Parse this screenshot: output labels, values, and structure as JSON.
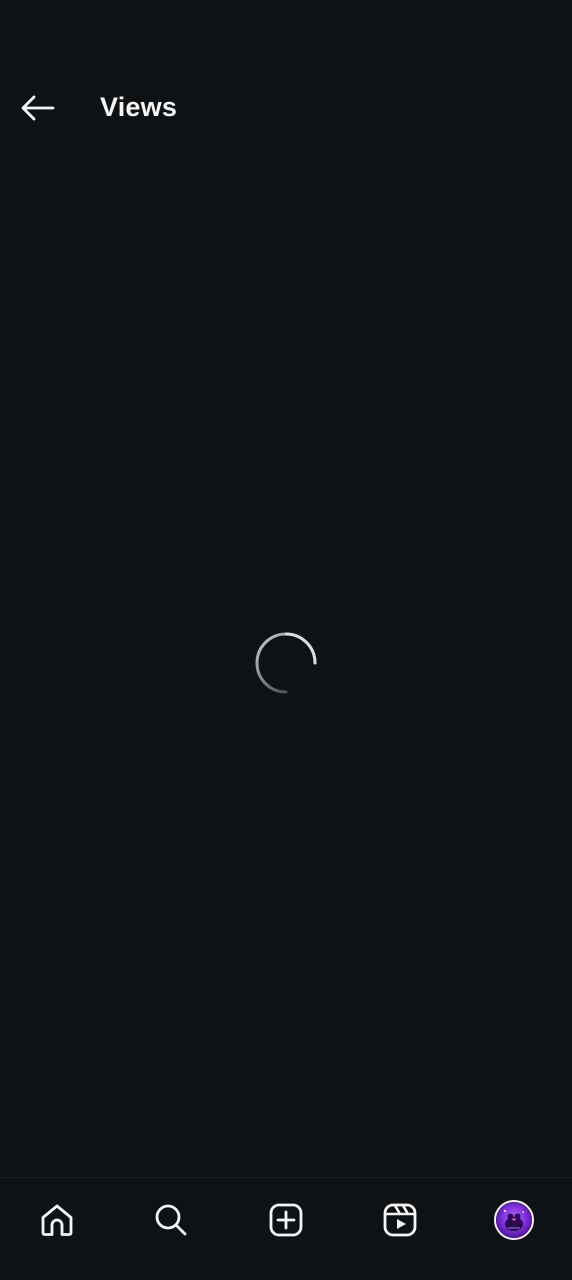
{
  "header": {
    "title": "Views",
    "back_icon": "arrow-left-icon"
  },
  "content": {
    "state": "loading",
    "spinner_icon": "loading-spinner-icon"
  },
  "tabbar": {
    "items": [
      {
        "name": "home",
        "icon": "home-icon"
      },
      {
        "name": "search",
        "icon": "search-icon"
      },
      {
        "name": "create",
        "icon": "plus-square-icon"
      },
      {
        "name": "reels",
        "icon": "reels-icon"
      },
      {
        "name": "profile",
        "icon": "profile-avatar-icon"
      }
    ]
  },
  "colors": {
    "background": "#0f1215",
    "foreground": "#f5f5f5",
    "avatar_primary": "#7a2bd6",
    "avatar_secondary": "#b36bff"
  }
}
